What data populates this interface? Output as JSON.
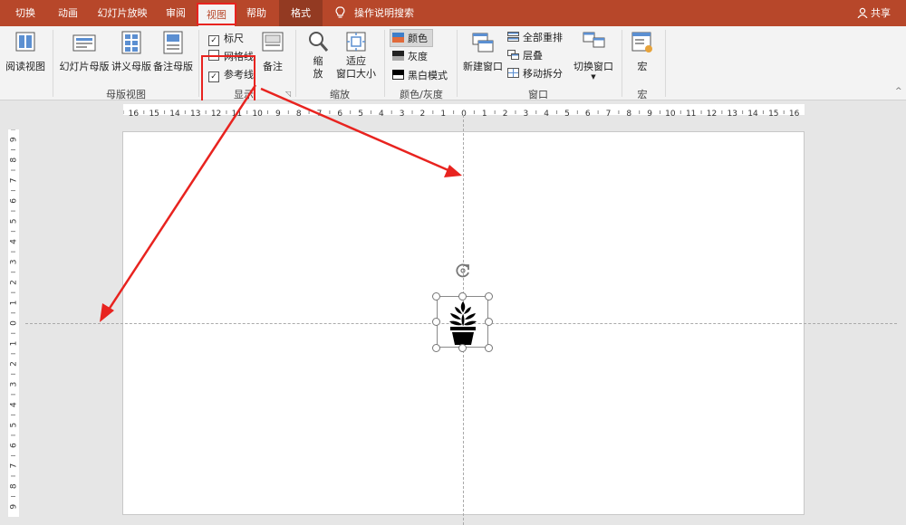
{
  "tabs": [
    {
      "label": "切换"
    },
    {
      "label": "动画"
    },
    {
      "label": "幻灯片放映"
    },
    {
      "label": "审阅"
    },
    {
      "label": "视图"
    },
    {
      "label": "帮助"
    },
    {
      "label": "格式"
    }
  ],
  "tell_me": "操作说明搜索",
  "share": "共享",
  "ribbon": {
    "reading_view": "阅读视图",
    "master_views": {
      "slide_master": "幻灯片母版",
      "handout_master": "讲义母版",
      "notes_master": "备注母版",
      "group_label": "母版视图"
    },
    "show": {
      "ruler": "标尺",
      "gridlines": "网格线",
      "guides": "参考线",
      "ruler_checked": true,
      "gridlines_checked": false,
      "guides_checked": true,
      "notes": "备注",
      "group_label": "显示"
    },
    "zoom": {
      "zoom_line1": "缩",
      "zoom_line2": "放",
      "fit_line1": "适应",
      "fit_line2": "窗口大小",
      "group_label": "缩放"
    },
    "color": {
      "color": "颜色",
      "grayscale": "灰度",
      "bw": "黑白模式",
      "group_label": "颜色/灰度"
    },
    "window": {
      "new_window": "新建窗口",
      "arrange_all": "全部重排",
      "cascade": "层叠",
      "move_split": "移动拆分",
      "switch_windows": "切换窗口",
      "group_label": "窗口"
    },
    "macros": {
      "macros": "宏",
      "group_label": "宏"
    }
  },
  "hruler_labels": [
    "16",
    "15",
    "14",
    "13",
    "12",
    "11",
    "10",
    "9",
    "8",
    "7",
    "6",
    "5",
    "4",
    "3",
    "2",
    "1",
    "0",
    "1",
    "2",
    "3",
    "4",
    "5",
    "6",
    "7",
    "8",
    "9",
    "10",
    "11",
    "12",
    "13",
    "14",
    "15",
    "16"
  ],
  "vruler_labels": [
    "9",
    "8",
    "7",
    "6",
    "5",
    "4",
    "3",
    "2",
    "1",
    "0",
    "1",
    "2",
    "3",
    "4",
    "5",
    "6",
    "7",
    "8",
    "9"
  ],
  "icons": {
    "accent": "#b7472a",
    "annotation": "#e8231f",
    "plant": "potted-plant-icon"
  }
}
